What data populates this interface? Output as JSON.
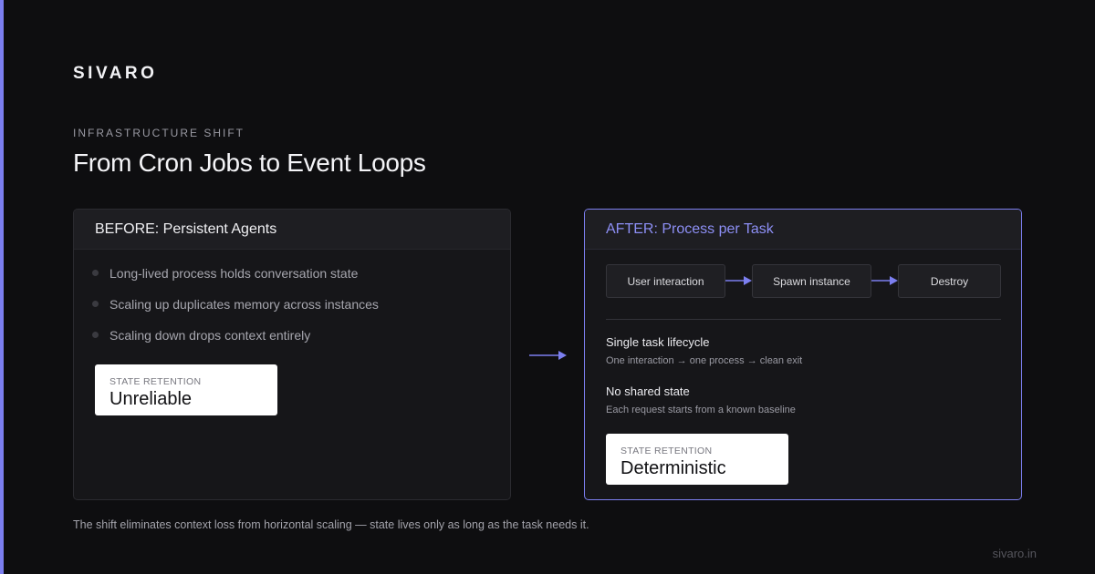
{
  "brand": "SIVARO",
  "eyebrow": "INFRASTRUCTURE SHIFT",
  "title": "From Cron Jobs to Event Loops",
  "before": {
    "heading": "BEFORE: Persistent Agents",
    "bullets": [
      "Long-lived process holds conversation state",
      "Scaling up duplicates memory across instances",
      "Scaling down drops context entirely"
    ],
    "state_label": "STATE RETENTION",
    "state_value": "Unreliable"
  },
  "after": {
    "heading": "AFTER: Process per Task",
    "flow": [
      "User interaction",
      "Spawn instance",
      "Destroy"
    ],
    "features": [
      {
        "title": "Single task lifecycle",
        "desc": "One interaction → one process → clean exit"
      },
      {
        "title": "No shared state",
        "desc": "Each request starts from a known baseline"
      }
    ],
    "state_label": "STATE RETENTION",
    "state_value": "Deterministic"
  },
  "footer_note": "The shift eliminates context loss from horizontal scaling — state lives only as long as the task needs it.",
  "site": "sivaro.in",
  "colors": {
    "background": "#0e0e10",
    "accent": "#7c7ff0",
    "card": "#161619",
    "state_box": "#ffffff"
  },
  "icons": {
    "transition_arrow": "arrow-right-icon",
    "flow_arrow": "arrow-right-icon",
    "bullet": "bullet-dot-icon"
  }
}
